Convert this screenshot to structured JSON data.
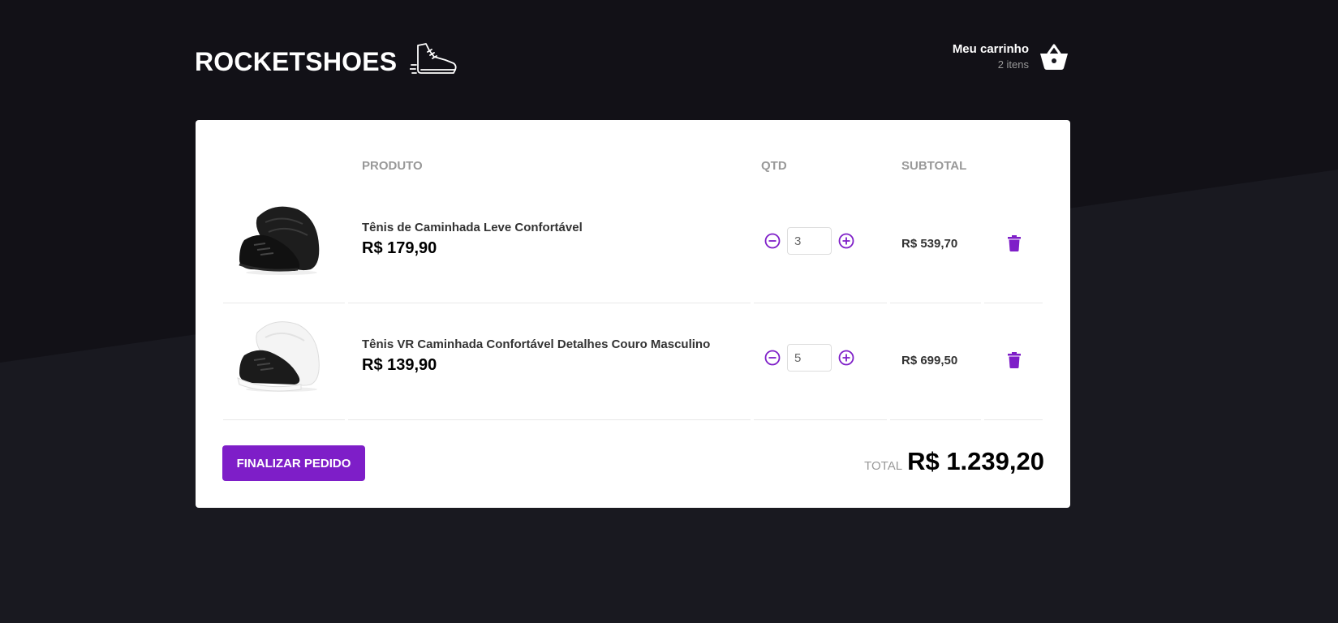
{
  "header": {
    "brand": "ROCKETSHOES",
    "cart": {
      "title": "Meu carrinho",
      "count": "2 itens"
    }
  },
  "table": {
    "headers": {
      "product": "PRODUTO",
      "qty": "QTD",
      "subtotal": "SUBTOTAL"
    },
    "items": [
      {
        "name": "Tênis de Caminhada Leve Confortável",
        "price": "R$ 179,90",
        "quantity": "3",
        "subtotal": "R$ 539,70",
        "image": "shoe-black-icon"
      },
      {
        "name": "Tênis VR Caminhada Confortável Detalhes Couro Masculino",
        "price": "R$ 139,90",
        "quantity": "5",
        "subtotal": "R$ 699,50",
        "image": "shoe-black-white-sole-icon"
      }
    ]
  },
  "footer": {
    "checkout_label": "Finalizar pedido",
    "total_label": "TOTAL",
    "total_value": "R$ 1.239,20"
  },
  "colors": {
    "accent": "#7e1ec8",
    "background": "#191920",
    "panel": "#ffffff"
  }
}
